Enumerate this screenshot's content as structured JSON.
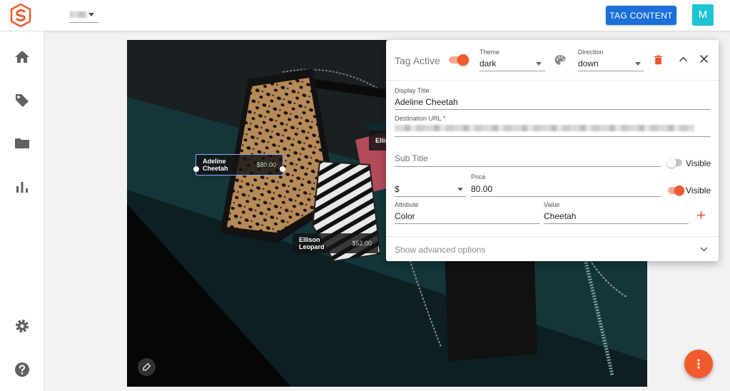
{
  "header": {
    "tag_button_label": "TAG CONTENT",
    "avatar_initial": "M",
    "workspace_icon": "blurred-workspace-name"
  },
  "sidebar": {
    "items": [
      {
        "icon": "home-icon"
      },
      {
        "icon": "tag-icon"
      },
      {
        "icon": "folder-icon"
      },
      {
        "icon": "bar-chart-icon"
      },
      {
        "icon": "gear-icon"
      },
      {
        "icon": "help-icon"
      }
    ]
  },
  "canvas": {
    "tags": [
      {
        "title": "Adeline Cheetah",
        "price": "$80.00",
        "selected": true
      },
      {
        "title": "Ellison Leopard",
        "price": "$52.00",
        "selected": false
      },
      {
        "title": "Ellis",
        "price": "",
        "selected": false
      }
    ]
  },
  "panel": {
    "tag_active_label": "Tag Active",
    "tag_active": true,
    "theme_label": "Theme",
    "theme_value": "dark",
    "direction_label": "Direction",
    "direction_value": "down",
    "display_title_label": "Display Title",
    "display_title_value": "Adeline Cheetah",
    "destination_url_label": "Destination URL *",
    "subtitle_placeholder": "Sub Title",
    "subtitle_visible_label": "Visible",
    "subtitle_visible": false,
    "currency_value": "$",
    "price_label": "Price",
    "price_value": "80.00",
    "price_visible_label": "Visible",
    "price_visible": true,
    "attribute_label": "Attribute",
    "attribute_value": "Color",
    "value_label": "Value",
    "value_value": "Cheetah",
    "advanced_label": "Show advanced options"
  },
  "colors": {
    "accent": "#f15a2b",
    "primary_button": "#1a6fd8",
    "avatar": "#1ec3d4"
  }
}
